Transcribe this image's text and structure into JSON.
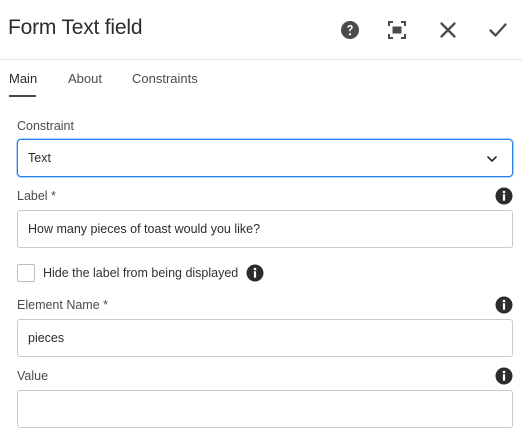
{
  "dialog": {
    "title": "Form Text field",
    "header_buttons": [
      "help-icon",
      "fullscreen-icon",
      "close-icon",
      "checkmark-icon"
    ]
  },
  "tabs": [
    {
      "label": "Main",
      "active": true
    },
    {
      "label": "About",
      "active": false
    },
    {
      "label": "Constraints",
      "active": false
    }
  ],
  "fields": {
    "constraint": {
      "label": "Constraint",
      "value": "Text"
    },
    "label": {
      "label": "Label *",
      "value": "How many pieces of toast would you like?"
    },
    "hide_label": {
      "label": "Hide the label from being displayed",
      "checked": false
    },
    "element_name": {
      "label": "Element Name *",
      "value": "pieces"
    },
    "value": {
      "label": "Value",
      "value": ""
    }
  },
  "colors": {
    "accent": "#2680eb",
    "icon": "#4b4b4b",
    "border": "#cacaca"
  }
}
